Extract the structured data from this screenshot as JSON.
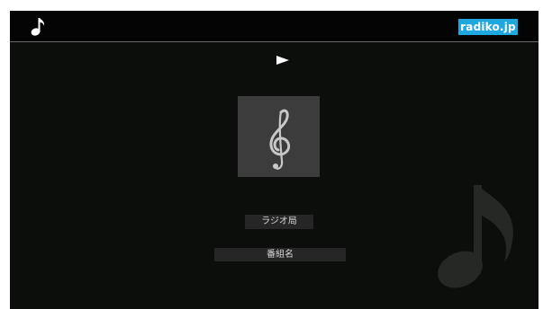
{
  "header": {
    "brand_label": "radiko.jp",
    "brand_color": "#1fa7e0",
    "app_icon": "music-note-icon"
  },
  "player": {
    "play_icon": "play-icon",
    "artwork_icon": "treble-clef-icon",
    "station_name": "ラジオ局",
    "program_name": "番組名"
  },
  "background": {
    "decoration_icon": "music-note-icon"
  }
}
